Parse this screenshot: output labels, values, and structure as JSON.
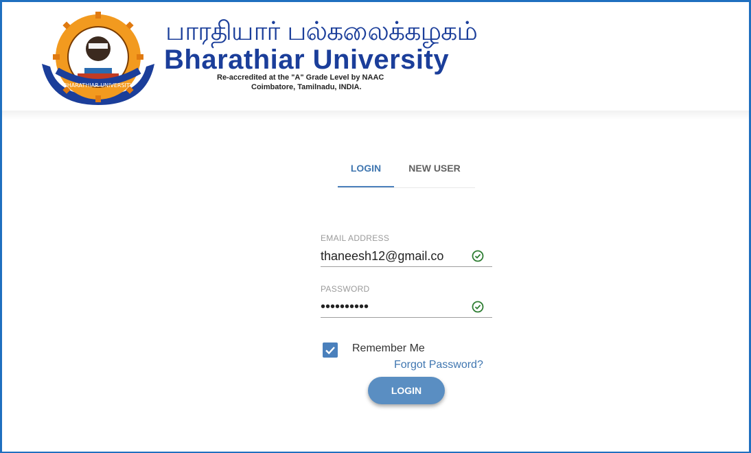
{
  "brand": {
    "tamil_name": "பாரதியார் பல்கலைக்கழகம்",
    "english_name": "Bharathiar University",
    "accreditation": "Re-accredited at the \"A\" Grade Level by NAAC",
    "location": "Coimbatore, Tamilnadu, INDIA.",
    "logo_icon": "university-seal-logo",
    "logo_banner_text": "BHARATHIAR UNIVERSITY",
    "colors": {
      "brand_blue": "#1b3e9a",
      "accent": "#4a80bc",
      "seal_orange": "#f29a1f",
      "valid": "#2e7d32"
    }
  },
  "tabs": [
    {
      "label": "LOGIN",
      "active": true
    },
    {
      "label": "NEW USER",
      "active": false
    }
  ],
  "form": {
    "email_label": "EMAIL ADDRESS",
    "email_value": "thaneesh12@gmail.co",
    "password_label": "PASSWORD",
    "password_value": "••••••••••",
    "remember_label": "Remember Me",
    "remember_checked": true,
    "forgot_label": "Forgot Password?",
    "submit_label": "LOGIN"
  }
}
